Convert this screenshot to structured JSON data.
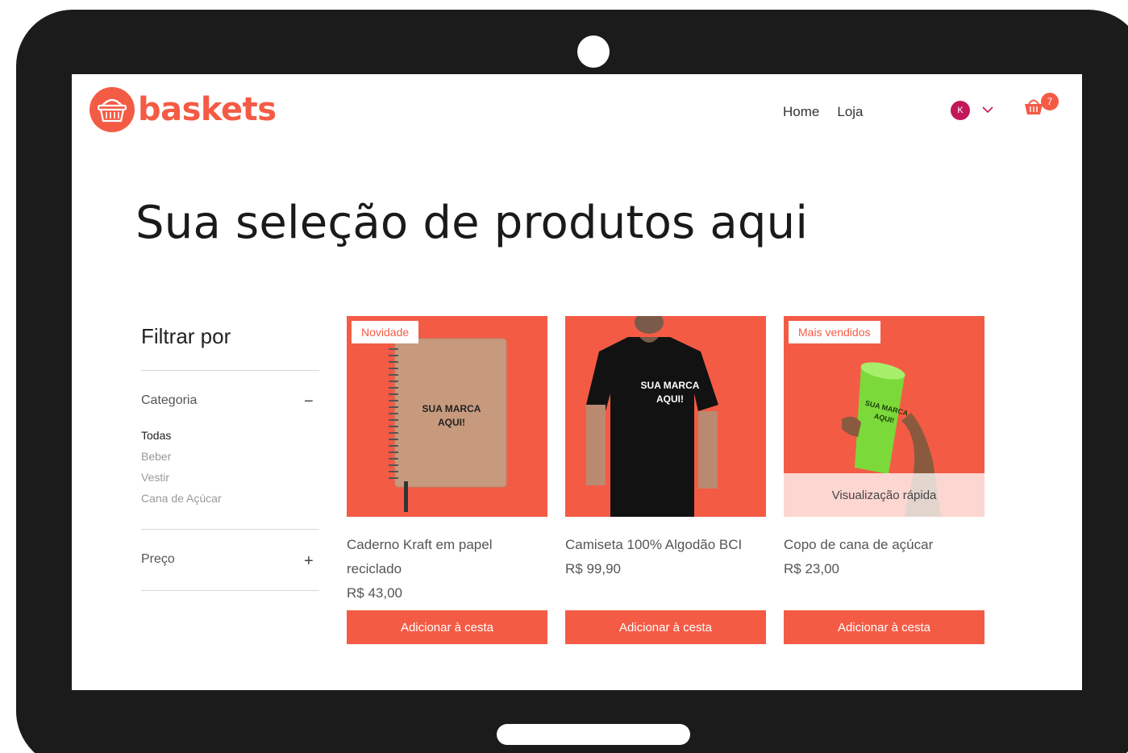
{
  "brand": {
    "name": "baskets",
    "color": "#f45b45",
    "logo_icon": "basket-icon"
  },
  "nav": {
    "items": [
      "Home",
      "Loja"
    ]
  },
  "account": {
    "avatar_initial": "K",
    "dropdown_icon": "chevron-down-icon"
  },
  "cart": {
    "icon": "cart-icon",
    "count": "7"
  },
  "page": {
    "title": "Sua seleção de produtos aqui"
  },
  "filter": {
    "title": "Filtrar por",
    "category": {
      "label": "Categoria",
      "toggle": "−",
      "items": [
        "Todas",
        "Beber",
        "Vestir",
        "Cana de Açúcar"
      ],
      "active": "Todas"
    },
    "price": {
      "label": "Preço",
      "toggle": "+"
    }
  },
  "products": [
    {
      "ribbon": "Novidade",
      "name_line1": "Caderno Kraft em papel",
      "name_line2": "reciclado",
      "price": "R$ 43,00",
      "button": "Adicionar à cesta",
      "image_text_1": "SUA MARCA",
      "image_text_2": "AQUI!"
    },
    {
      "ribbon": "",
      "name_line1": "Camiseta 100% Algodão BCI",
      "name_line2": "",
      "price": "R$ 99,90",
      "button": "Adicionar à cesta",
      "image_text_1": "SUA MARCA",
      "image_text_2": "AQUI!"
    },
    {
      "ribbon": "Mais vendidos",
      "name_line1": "Copo de cana de açúcar",
      "name_line2": "",
      "price": "R$ 23,00",
      "button": "Adicionar à cesta",
      "quick_view": "Visualização rápida",
      "image_text_1": "SUA MARCA",
      "image_text_2": "AQUI!"
    }
  ]
}
